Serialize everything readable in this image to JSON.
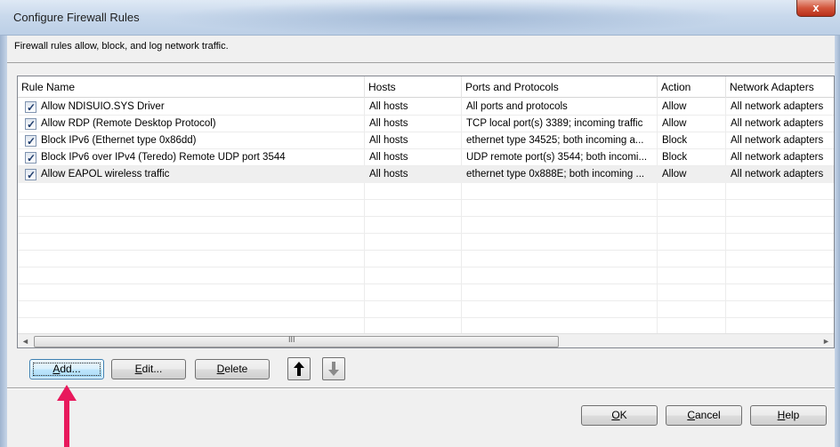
{
  "window": {
    "title": "Configure Firewall Rules",
    "close_glyph": "x"
  },
  "description": "Firewall rules allow, block, and log network traffic.",
  "columns": [
    "Rule Name",
    "Hosts",
    "Ports and Protocols",
    "Action",
    "Network Adapters"
  ],
  "rules": [
    {
      "checked": true,
      "name": "Allow NDISUIO.SYS Driver",
      "hosts": "All hosts",
      "ports": "All ports and protocols",
      "action": "Allow",
      "adapters": "All network adapters"
    },
    {
      "checked": true,
      "name": "Allow RDP (Remote Desktop Protocol)",
      "hosts": "All hosts",
      "ports": "TCP local port(s) 3389; incoming traffic",
      "action": "Allow",
      "adapters": "All network adapters"
    },
    {
      "checked": true,
      "name": "Block IPv6 (Ethernet type 0x86dd)",
      "hosts": "All hosts",
      "ports": "ethernet type 34525; both incoming a...",
      "action": "Block",
      "adapters": "All network adapters"
    },
    {
      "checked": true,
      "name": "Block IPv6 over IPv4 (Teredo) Remote UDP port 3544",
      "hosts": "All hosts",
      "ports": "UDP remote port(s) 3544; both incomi...",
      "action": "Block",
      "adapters": "All network adapters"
    },
    {
      "checked": true,
      "name": "Allow EAPOL wireless traffic",
      "hosts": "All hosts",
      "ports": "ethernet type 0x888E; both incoming ...",
      "action": "Allow",
      "adapters": "All network adapters"
    }
  ],
  "scrollbar": {
    "left_arrow": "◄",
    "right_arrow": "►",
    "grip": "III"
  },
  "buttons": {
    "add": {
      "accel": "A",
      "rest": "dd..."
    },
    "edit": {
      "accel": "E",
      "rest": "dit..."
    },
    "delete": {
      "accel": "D",
      "rest": "elete"
    },
    "move_up": "🡅",
    "move_down": "🡇",
    "ok": {
      "accel": "O",
      "rest": "K"
    },
    "cancel": {
      "accel": "C",
      "rest": "ancel"
    },
    "help": {
      "accel": "H",
      "rest": "elp"
    }
  },
  "colors": {
    "annotation_arrow": "#e8195c",
    "selected_row": "#efefef"
  }
}
